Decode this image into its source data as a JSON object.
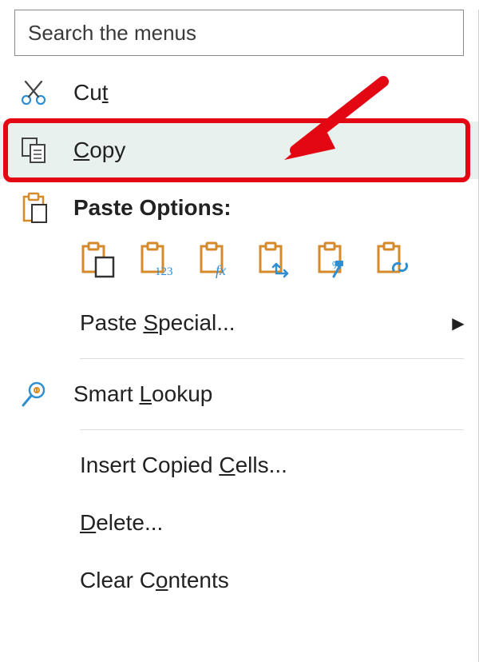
{
  "search": {
    "placeholder": "Search the menus"
  },
  "menu": {
    "cut": "Cut",
    "copy": "Copy",
    "paste_options_label": "Paste Options:",
    "paste_special": "Paste Special...",
    "smart_lookup": "Smart Lookup",
    "insert_copied": "Insert Copied Cells...",
    "delete": "Delete...",
    "clear_contents": "Clear Contents"
  },
  "underline": {
    "cut_idx": 2,
    "copy_idx": 0,
    "paste_special_idx": 6,
    "smart_lookup_idx": 6,
    "insert_copied_idx": 14,
    "delete_idx": 0,
    "clear_contents_idx": 7
  },
  "paste_icons": [
    "paste-keep-source",
    "paste-values",
    "paste-formulas",
    "paste-transpose",
    "paste-formatting",
    "paste-link"
  ],
  "annotation": {
    "highlight_target": "copy",
    "arrow": true
  }
}
